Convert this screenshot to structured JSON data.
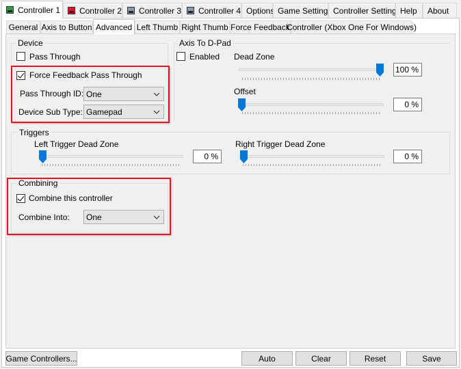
{
  "top_tabs": [
    {
      "label": "Controller 1",
      "color": "#2ea043"
    },
    {
      "label": "Controller 2",
      "color": "#e81123"
    },
    {
      "label": "Controller 3",
      "color": "#6b7b8c"
    },
    {
      "label": "Controller 4",
      "color": "#6b7b8c"
    },
    {
      "label": "Options"
    },
    {
      "label": "Game Settings"
    },
    {
      "label": "Controller Settings"
    },
    {
      "label": "Help"
    },
    {
      "label": "About"
    }
  ],
  "sub_tabs": [
    "General",
    "Axis to Button",
    "Advanced",
    "Left Thumb",
    "Right Thumb",
    "Force Feedback",
    "Controller (Xbox One For Windows)"
  ],
  "device": {
    "title": "Device",
    "pass_through": {
      "label": "Pass Through",
      "checked": false
    },
    "ff_pass_through": {
      "label": "Force Feedback Pass Through",
      "checked": true
    },
    "pass_through_id_label": "Pass Through ID:",
    "pass_through_id_value": "One",
    "sub_type_label": "Device Sub Type:",
    "sub_type_value": "Gamepad"
  },
  "dpad": {
    "title": "Axis To D-Pad",
    "enabled": {
      "label": "Enabled",
      "checked": false
    },
    "dead_zone_label": "Dead Zone",
    "dead_zone_value": "100 %",
    "dead_zone_level": 1.0,
    "offset_label": "Offset",
    "offset_value": "0 %",
    "offset_level": 0.0
  },
  "triggers": {
    "title": "Triggers",
    "left_label": "Left Trigger Dead Zone",
    "left_value": "0 %",
    "left_level": 0.0,
    "right_label": "Right Trigger Dead Zone",
    "right_value": "0 %",
    "right_level": 0.0
  },
  "combining": {
    "title": "Combining",
    "combine": {
      "label": "Combine this controller",
      "checked": true
    },
    "combine_into_label": "Combine Into:",
    "combine_into_value": "One"
  },
  "buttons": {
    "game_controllers": "Game Controllers...",
    "auto": "Auto",
    "clear": "Clear",
    "reset": "Reset",
    "save": "Save"
  },
  "colors": {
    "highlight": "#e81123",
    "slider_thumb": "#0078d7"
  }
}
